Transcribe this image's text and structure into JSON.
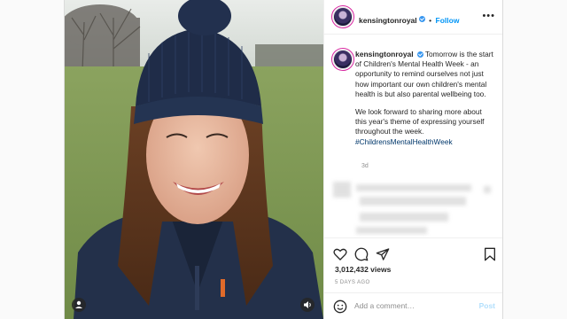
{
  "post": {
    "username": "kensingtonroyal",
    "follow_label": "Follow",
    "dot_separator": "•",
    "more_label": "•••",
    "caption_p1": "Tomorrow is the start of Children's Mental Health Week - an opportunity to remind ourselves not just how important our own children's mental health is but also parental wellbeing too.",
    "caption_p2": "We look forward to sharing more about this year's theme of expressing yourself throughout the week.",
    "hashtag": "#ChildrensMentalHealthWeek",
    "time_ago": "3d",
    "views": "3,012,432 views",
    "days_ago": "5 DAYS AGO",
    "comment_placeholder": "Add a comment…",
    "post_button": "Post"
  },
  "colors": {
    "link_blue": "#0095f6",
    "verified_blue": "#3897f0",
    "hashtag_navy": "#00376b",
    "text": "#262626",
    "muted": "#8e8e8e"
  },
  "icons": [
    "verified-badge-icon",
    "more-icon",
    "heart-icon",
    "comment-icon",
    "share-icon",
    "bookmark-icon",
    "emoji-icon",
    "user-tag-icon",
    "audio-icon"
  ]
}
